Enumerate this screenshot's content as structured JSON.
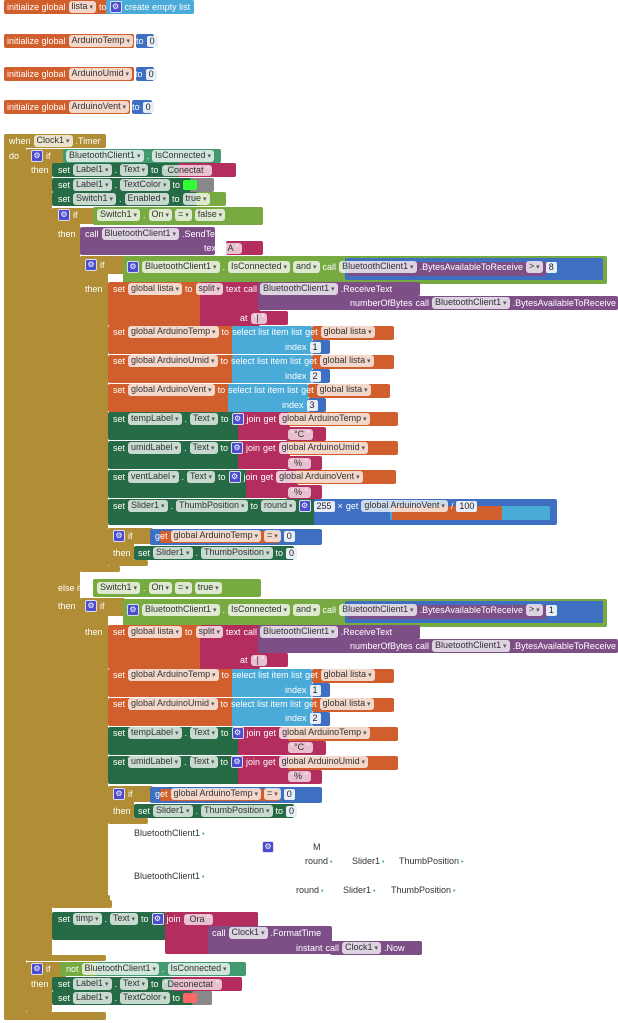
{
  "colors": {
    "control": "#b18e35",
    "orange": "#d05f2d",
    "math": "#3f6fc0",
    "lightblue": "#4aaad8",
    "magenta": "#b32d5e",
    "purple": "#7d4f86",
    "setgreen": "#266b45",
    "compgreen": "#439970",
    "logic": "#77ab41",
    "gray": "#888888",
    "swatch_green": "#33ff33",
    "swatch_red": "#ff6666"
  },
  "rows": [
    {
      "t": [
        [
          "k",
          "initialize global"
        ],
        [
          "d",
          "lista"
        ],
        [
          "k",
          "to"
        ],
        [
          "g",
          "gear"
        ],
        [
          "k",
          "create empty list"
        ]
      ]
    },
    {
      "t": [
        [
          "k",
          "initialize global"
        ],
        [
          "d",
          "ArduinoTemp"
        ],
        [
          "k",
          "to"
        ],
        [
          "n",
          "0"
        ]
      ]
    },
    {
      "t": [
        [
          "k",
          "initialize global"
        ],
        [
          "d",
          "ArduinoUmid"
        ],
        [
          "k",
          "to"
        ],
        [
          "n",
          "0"
        ]
      ]
    },
    {
      "t": [
        [
          "k",
          "initialize global"
        ],
        [
          "d",
          "ArduinoVent"
        ],
        [
          "k",
          "to"
        ],
        [
          "n",
          "0"
        ]
      ]
    },
    {
      "t": [
        [
          "k",
          "when"
        ],
        [
          "d",
          "Clock1"
        ],
        [
          "k",
          ".Timer"
        ]
      ]
    },
    {
      "t": [
        [
          "k",
          "do"
        ]
      ]
    },
    {
      "t": [
        [
          "g",
          "gear"
        ],
        [
          "k",
          "if"
        ]
      ]
    },
    {
      "t": [
        [
          "d",
          "BluetoothClient1"
        ],
        [
          "k",
          "."
        ],
        [
          "d",
          "IsConnected"
        ]
      ]
    },
    {
      "t": [
        [
          "k",
          "then"
        ]
      ]
    },
    {
      "t": [
        [
          "k",
          "set"
        ],
        [
          "d",
          "Label1"
        ],
        [
          "k",
          "."
        ],
        [
          "d",
          "Text"
        ],
        [
          "k",
          "to"
        ],
        [
          "l",
          "Conectat"
        ]
      ]
    },
    {
      "t": [
        [
          "k",
          "set"
        ],
        [
          "d",
          "Label1"
        ],
        [
          "k",
          "."
        ],
        [
          "d",
          "TextColor"
        ],
        [
          "k",
          "to"
        ],
        [
          "s",
          "swatch_green"
        ]
      ]
    },
    {
      "t": [
        [
          "k",
          "set"
        ],
        [
          "d",
          "Switch1"
        ],
        [
          "k",
          "."
        ],
        [
          "d",
          "Enabled"
        ],
        [
          "k",
          "to"
        ],
        [
          "d",
          "true"
        ]
      ]
    },
    {
      "t": [
        [
          "g",
          "gear"
        ],
        [
          "k",
          "if"
        ]
      ]
    },
    {
      "t": [
        [
          "d",
          "Switch1"
        ],
        [
          "k",
          "."
        ],
        [
          "d",
          "On"
        ],
        [
          "d",
          "="
        ],
        [
          "d",
          "false"
        ]
      ]
    },
    {
      "t": [
        [
          "k",
          "then"
        ]
      ]
    },
    {
      "t": [
        [
          "k",
          "call"
        ],
        [
          "d",
          "BluetoothClient1"
        ],
        [
          "k",
          ".SendText"
        ]
      ]
    },
    {
      "t": [
        [
          "k",
          "text"
        ],
        [
          "l",
          "A"
        ]
      ]
    },
    {
      "t": [
        [
          "g",
          "gear"
        ],
        [
          "k",
          "if"
        ]
      ]
    },
    {
      "t": [
        [
          "g",
          "gear"
        ],
        [
          "d",
          "BluetoothClient1"
        ],
        [
          "k",
          "."
        ],
        [
          "d",
          "IsConnected"
        ],
        [
          "d",
          "and"
        ],
        [
          "k",
          "call"
        ],
        [
          "d",
          "BluetoothClient1"
        ],
        [
          "k",
          ".BytesAvailableToReceive"
        ],
        [
          "d",
          ">"
        ],
        [
          "n",
          "8"
        ]
      ]
    },
    {
      "t": [
        [
          "k",
          "then"
        ]
      ]
    },
    {
      "t": [
        [
          "k",
          "set"
        ],
        [
          "d",
          "global lista"
        ],
        [
          "k",
          "to"
        ],
        [
          "d",
          "split"
        ],
        [
          "k",
          "text"
        ],
        [
          "k",
          "call"
        ],
        [
          "d",
          "BluetoothClient1"
        ],
        [
          "k",
          ".ReceiveText"
        ]
      ]
    },
    {
      "t": [
        [
          "k",
          "numberOfBytes"
        ],
        [
          "k",
          "call"
        ],
        [
          "d",
          "BluetoothClient1"
        ],
        [
          "k",
          ".BytesAvailableToReceive"
        ]
      ]
    },
    {
      "t": [
        [
          "k",
          "at"
        ],
        [
          "l",
          "|"
        ]
      ]
    },
    {
      "t": [
        [
          "k",
          "set"
        ],
        [
          "d",
          "global ArduinoTemp"
        ],
        [
          "k",
          "to"
        ],
        [
          "k",
          "select list item  list"
        ],
        [
          "k",
          "get"
        ],
        [
          "d",
          "global lista"
        ]
      ]
    },
    {
      "t": [
        [
          "k",
          "index"
        ],
        [
          "n",
          "1"
        ]
      ]
    },
    {
      "t": [
        [
          "k",
          "set"
        ],
        [
          "d",
          "global ArduinoUmid"
        ],
        [
          "k",
          "to"
        ],
        [
          "k",
          "select list item  list"
        ],
        [
          "k",
          "get"
        ],
        [
          "d",
          "global lista"
        ]
      ]
    },
    {
      "t": [
        [
          "k",
          "index"
        ],
        [
          "n",
          "2"
        ]
      ]
    },
    {
      "t": [
        [
          "k",
          "set"
        ],
        [
          "d",
          "global ArduinoVent"
        ],
        [
          "k",
          "to"
        ],
        [
          "k",
          "select list item  list"
        ],
        [
          "k",
          "get"
        ],
        [
          "d",
          "global lista"
        ]
      ]
    },
    {
      "t": [
        [
          "k",
          "index"
        ],
        [
          "n",
          "3"
        ]
      ]
    },
    {
      "t": [
        [
          "k",
          "set"
        ],
        [
          "d",
          "tempLabel"
        ],
        [
          "k",
          "."
        ],
        [
          "d",
          "Text"
        ],
        [
          "k",
          "to"
        ],
        [
          "g",
          "gear"
        ],
        [
          "k",
          "join"
        ],
        [
          "k",
          "get"
        ],
        [
          "d",
          "global ArduinoTemp"
        ]
      ]
    },
    {
      "t": [
        [
          "l",
          "°C"
        ]
      ]
    },
    {
      "t": [
        [
          "k",
          "set"
        ],
        [
          "d",
          "umidLabel"
        ],
        [
          "k",
          "."
        ],
        [
          "d",
          "Text"
        ],
        [
          "k",
          "to"
        ],
        [
          "g",
          "gear"
        ],
        [
          "k",
          "join"
        ],
        [
          "k",
          "get"
        ],
        [
          "d",
          "global ArduinoUmid"
        ]
      ]
    },
    {
      "t": [
        [
          "l",
          "%"
        ]
      ]
    },
    {
      "t": [
        [
          "k",
          "set"
        ],
        [
          "d",
          "ventLabel"
        ],
        [
          "k",
          "."
        ],
        [
          "d",
          "Text"
        ],
        [
          "k",
          "to"
        ],
        [
          "g",
          "gear"
        ],
        [
          "k",
          "join"
        ],
        [
          "k",
          "get"
        ],
        [
          "d",
          "global ArduinoVent"
        ]
      ]
    },
    {
      "t": [
        [
          "l",
          "%"
        ]
      ]
    },
    {
      "t": [
        [
          "k",
          "set"
        ],
        [
          "d",
          "Slider1"
        ],
        [
          "k",
          "."
        ],
        [
          "d",
          "ThumbPosition"
        ],
        [
          "k",
          "to"
        ],
        [
          "d",
          "round"
        ],
        [
          "g",
          "gear"
        ],
        [
          "n",
          "255"
        ],
        [
          "k",
          "×"
        ],
        [
          "k",
          "get"
        ],
        [
          "d",
          "global ArduinoVent"
        ],
        [
          "k",
          "/"
        ],
        [
          "n",
          "100"
        ]
      ]
    },
    {
      "t": [
        [
          "g",
          "gear"
        ],
        [
          "k",
          "if"
        ]
      ]
    },
    {
      "t": [
        [
          "k",
          "get"
        ],
        [
          "d",
          "global ArduinoTemp"
        ],
        [
          "d",
          "="
        ],
        [
          "n",
          "0"
        ]
      ]
    },
    {
      "t": [
        [
          "k",
          "then"
        ]
      ]
    },
    {
      "t": [
        [
          "k",
          "set"
        ],
        [
          "d",
          "Slider1"
        ],
        [
          "k",
          "."
        ],
        [
          "d",
          "ThumbPosition"
        ],
        [
          "k",
          "to"
        ],
        [
          "n",
          "0"
        ]
      ]
    },
    {
      "t": [
        [
          "k",
          "else if"
        ]
      ]
    },
    {
      "t": [
        [
          "d",
          "Switch1"
        ],
        [
          "k",
          "."
        ],
        [
          "d",
          "On"
        ],
        [
          "d",
          "="
        ],
        [
          "d",
          "true"
        ]
      ]
    },
    {
      "t": [
        [
          "k",
          "then"
        ]
      ]
    },
    {
      "t": [
        [
          "g",
          "gear"
        ],
        [
          "k",
          "if"
        ]
      ]
    },
    {
      "t": [
        [
          "g",
          "gear"
        ],
        [
          "d",
          "BluetoothClient1"
        ],
        [
          "k",
          "."
        ],
        [
          "d",
          "IsConnected"
        ],
        [
          "d",
          "and"
        ],
        [
          "k",
          "call"
        ],
        [
          "d",
          "BluetoothClient1"
        ],
        [
          "k",
          ".BytesAvailableToReceive"
        ],
        [
          "d",
          ">"
        ],
        [
          "n",
          "1"
        ]
      ]
    },
    {
      "t": [
        [
          "k",
          "then"
        ]
      ]
    },
    {
      "t": [
        [
          "k",
          "set"
        ],
        [
          "d",
          "global lista"
        ],
        [
          "k",
          "to"
        ],
        [
          "d",
          "split"
        ],
        [
          "k",
          "text"
        ],
        [
          "k",
          "call"
        ],
        [
          "d",
          "BluetoothClient1"
        ],
        [
          "k",
          ".ReceiveText"
        ]
      ]
    },
    {
      "t": [
        [
          "k",
          "numberOfBytes"
        ],
        [
          "k",
          "call"
        ],
        [
          "d",
          "BluetoothClient1"
        ],
        [
          "k",
          ".BytesAvailableToReceive"
        ]
      ]
    },
    {
      "t": [
        [
          "k",
          "at"
        ],
        [
          "l",
          "|"
        ]
      ]
    },
    {
      "t": [
        [
          "k",
          "set"
        ],
        [
          "d",
          "global ArduinoTemp"
        ],
        [
          "k",
          "to"
        ],
        [
          "k",
          "select list item  list"
        ],
        [
          "k",
          "get"
        ],
        [
          "d",
          "global lista"
        ]
      ]
    },
    {
      "t": [
        [
          "k",
          "index"
        ],
        [
          "n",
          "1"
        ]
      ]
    },
    {
      "t": [
        [
          "k",
          "set"
        ],
        [
          "d",
          "global ArduinoUmid"
        ],
        [
          "k",
          "to"
        ],
        [
          "k",
          "select list item  list"
        ],
        [
          "k",
          "get"
        ],
        [
          "d",
          "global lista"
        ]
      ]
    },
    {
      "t": [
        [
          "k",
          "index"
        ],
        [
          "n",
          "2"
        ]
      ]
    },
    {
      "t": [
        [
          "k",
          "set"
        ],
        [
          "d",
          "tempLabel"
        ],
        [
          "k",
          "."
        ],
        [
          "d",
          "Text"
        ],
        [
          "k",
          "to"
        ],
        [
          "g",
          "gear"
        ],
        [
          "k",
          "join"
        ],
        [
          "k",
          "get"
        ],
        [
          "d",
          "global ArduinoTemp"
        ]
      ]
    },
    {
      "t": [
        [
          "l",
          "°C"
        ]
      ]
    },
    {
      "t": [
        [
          "k",
          "set"
        ],
        [
          "d",
          "umidLabel"
        ],
        [
          "k",
          "."
        ],
        [
          "d",
          "Text"
        ],
        [
          "k",
          "to"
        ],
        [
          "g",
          "gear"
        ],
        [
          "k",
          "join"
        ],
        [
          "k",
          "get"
        ],
        [
          "d",
          "global ArduinoUmid"
        ]
      ]
    },
    {
      "t": [
        [
          "l",
          "%"
        ]
      ]
    },
    {
      "t": [
        [
          "g",
          "gear"
        ],
        [
          "k",
          "if"
        ]
      ]
    },
    {
      "t": [
        [
          "k",
          "get"
        ],
        [
          "d",
          "global ArduinoTemp"
        ],
        [
          "d",
          "="
        ],
        [
          "n",
          "0"
        ]
      ]
    },
    {
      "t": [
        [
          "k",
          "then"
        ]
      ]
    },
    {
      "t": [
        [
          "k",
          "set"
        ],
        [
          "d",
          "Slider1"
        ],
        [
          "k",
          "."
        ],
        [
          "d",
          "ThumbPosition"
        ],
        [
          "k",
          "to"
        ],
        [
          "n",
          "0"
        ]
      ]
    },
    {
      "t": [
        [
          "x",
          "BluetoothClient1"
        ]
      ]
    },
    {
      "t": [
        [
          "g",
          "gear"
        ]
      ]
    },
    {
      "t": [
        [
          "y",
          "M"
        ]
      ]
    },
    {
      "t": [
        [
          "x",
          "round"
        ]
      ]
    },
    {
      "t": [
        [
          "x",
          "Slider1"
        ]
      ]
    },
    {
      "t": [
        [
          "x",
          "ThumbPosition"
        ]
      ]
    },
    {
      "t": [
        [
          "x",
          "BluetoothClient1"
        ]
      ]
    },
    {
      "t": [
        [
          "x",
          "round"
        ]
      ]
    },
    {
      "t": [
        [
          "x",
          "Slider1"
        ]
      ]
    },
    {
      "t": [
        [
          "x",
          "ThumbPosition"
        ]
      ]
    },
    {
      "t": [
        [
          "k",
          "set"
        ],
        [
          "d",
          "timp"
        ],
        [
          "k",
          "."
        ],
        [
          "d",
          "Text"
        ],
        [
          "k",
          "to"
        ],
        [
          "g",
          "gear"
        ],
        [
          "k",
          "join"
        ],
        [
          "l",
          "Ora"
        ]
      ]
    },
    {
      "t": [
        [
          "k",
          "call"
        ],
        [
          "d",
          "Clock1"
        ],
        [
          "k",
          ".FormatTime"
        ]
      ]
    },
    {
      "t": [
        [
          "k",
          "instant"
        ],
        [
          "k",
          "call"
        ],
        [
          "d",
          "Clock1"
        ],
        [
          "k",
          ".Now"
        ]
      ]
    },
    {
      "t": [
        [
          "g",
          "gear"
        ],
        [
          "k",
          "if"
        ]
      ]
    },
    {
      "t": [
        [
          "k",
          "not"
        ],
        [
          "d",
          "BluetoothClient1"
        ],
        [
          "k",
          "."
        ],
        [
          "d",
          "IsConnected"
        ]
      ]
    },
    {
      "t": [
        [
          "k",
          "then"
        ]
      ]
    },
    {
      "t": [
        [
          "k",
          "set"
        ],
        [
          "d",
          "Label1"
        ],
        [
          "k",
          "."
        ],
        [
          "d",
          "Text"
        ],
        [
          "k",
          "to"
        ],
        [
          "l",
          "Deconectat"
        ]
      ]
    },
    {
      "t": [
        [
          "k",
          "set"
        ],
        [
          "d",
          "Label1"
        ],
        [
          "k",
          "."
        ],
        [
          "d",
          "TextColor"
        ],
        [
          "k",
          "to"
        ],
        [
          "s",
          "swatch_red"
        ]
      ]
    }
  ]
}
